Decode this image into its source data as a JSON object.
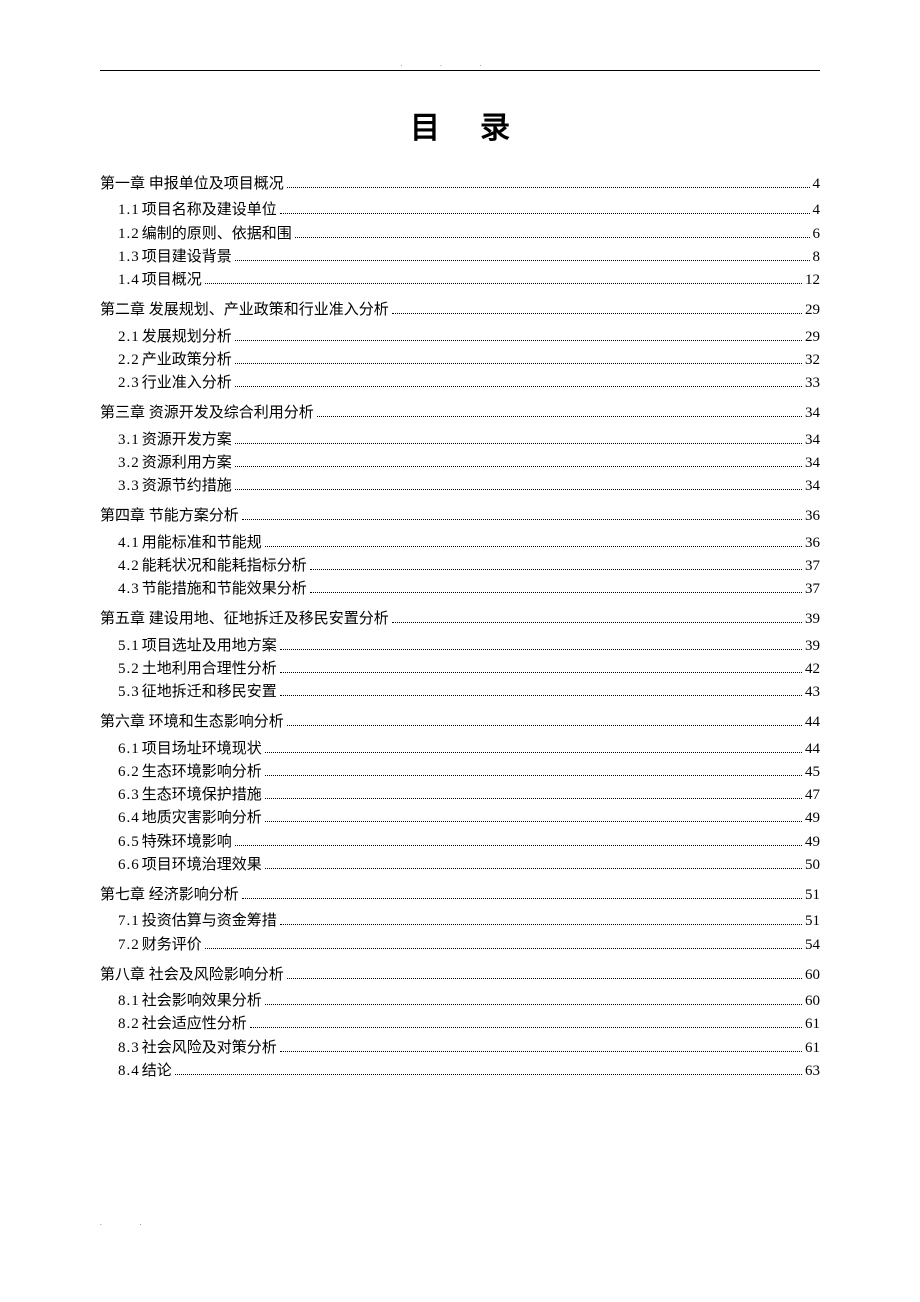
{
  "title": "目录",
  "toc": [
    {
      "chapter": "第一章",
      "chapter_title": "申报单位及项目概况",
      "page": "4",
      "sections": [
        {
          "num": "1.1",
          "title": "项目名称及建设单位",
          "page": "4"
        },
        {
          "num": "1.2",
          "title": "编制的原则、依据和围",
          "page": "6"
        },
        {
          "num": "1.3",
          "title": "项目建设背景",
          "page": "8"
        },
        {
          "num": "1.4",
          "title": "项目概况",
          "page": "12"
        }
      ]
    },
    {
      "chapter": "第二章",
      "chapter_title": "发展规划、产业政策和行业准入分析",
      "page": "29",
      "sections": [
        {
          "num": "2.1",
          "title": "发展规划分析",
          "page": "29"
        },
        {
          "num": "2.2",
          "title": "产业政策分析",
          "page": "32"
        },
        {
          "num": "2.3",
          "title": "行业准入分析",
          "page": "33"
        }
      ]
    },
    {
      "chapter": "第三章",
      "chapter_title": "资源开发及综合利用分析",
      "page": "34",
      "sections": [
        {
          "num": "3.1",
          "title": "资源开发方案",
          "page": "34"
        },
        {
          "num": "3.2",
          "title": "资源利用方案",
          "page": "34"
        },
        {
          "num": "3.3",
          "title": "资源节约措施",
          "page": "34"
        }
      ]
    },
    {
      "chapter": "第四章",
      "chapter_title": "节能方案分析",
      "page": "36",
      "sections": [
        {
          "num": "4.1",
          "title": "用能标准和节能规",
          "page": "36"
        },
        {
          "num": "4.2",
          "title": "能耗状况和能耗指标分析",
          "page": "37"
        },
        {
          "num": "4.3",
          "title": "节能措施和节能效果分析",
          "page": "37"
        }
      ]
    },
    {
      "chapter": "第五章",
      "chapter_title": "建设用地、征地拆迁及移民安置分析",
      "page": "39",
      "sections": [
        {
          "num": "5.1",
          "title": "项目选址及用地方案",
          "page": "39"
        },
        {
          "num": "5.2",
          "title": "土地利用合理性分析",
          "page": "42"
        },
        {
          "num": "5.3",
          "title": "征地拆迁和移民安置",
          "page": "43"
        }
      ]
    },
    {
      "chapter": "第六章",
      "chapter_title": "环境和生态影响分析",
      "page": "44",
      "sections": [
        {
          "num": "6.1",
          "title": "项目场址环境现状",
          "page": "44"
        },
        {
          "num": "6.2",
          "title": "生态环境影响分析",
          "page": "45"
        },
        {
          "num": "6.3",
          "title": "生态环境保护措施",
          "page": "47"
        },
        {
          "num": "6.4",
          "title": "地质灾害影响分析",
          "page": "49"
        },
        {
          "num": "6.5",
          "title": "特殊环境影响",
          "page": "49"
        },
        {
          "num": "6.6",
          "title": "项目环境治理效果",
          "page": "50"
        }
      ]
    },
    {
      "chapter": "第七章",
      "chapter_title": "经济影响分析",
      "page": "51",
      "sections": [
        {
          "num": "7.1",
          "title": "投资估算与资金筹措",
          "page": "51"
        },
        {
          "num": "7.2",
          "title": "财务评价",
          "page": "54"
        }
      ]
    },
    {
      "chapter": "第八章",
      "chapter_title": "社会及风险影响分析",
      "page": "60",
      "sections": [
        {
          "num": "8.1",
          "title": "社会影响效果分析",
          "page": "60"
        },
        {
          "num": "8.2",
          "title": "社会适应性分析",
          "page": "61"
        },
        {
          "num": "8.3",
          "title": "社会风险及对策分析",
          "page": "61"
        },
        {
          "num": "8.4",
          "title": "结论",
          "page": "63"
        }
      ]
    }
  ]
}
